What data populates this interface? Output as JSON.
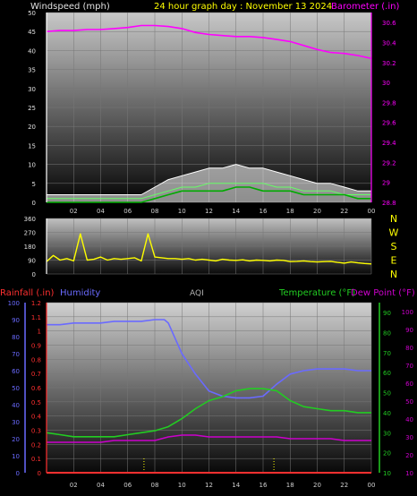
{
  "header": {
    "wind_label": "Windspeed (mph)",
    "title": "24 hour graph day : November 13 2024",
    "baro_label": "Barometer (.in)"
  },
  "lower_header": {
    "rain_label": "Rainfall (.in)",
    "humidity_label": "Humidity",
    "aqi_label": "AQI",
    "temp_label": "Temperature (°F)",
    "dew_label": "Dew Point (°F)"
  },
  "colors": {
    "wind_label": "#e0e0e0",
    "title": "#ffff00",
    "barometer": "#ff00ff",
    "direction": "#ffff00",
    "rain": "#ff3030",
    "humidity": "#6a6aff",
    "aqi": "#b0b0b0",
    "temperature": "#22cc22",
    "dew_point": "#cc00cc"
  },
  "compass": [
    "N",
    "W",
    "S",
    "E",
    "N"
  ],
  "chart_data": [
    {
      "type": "line",
      "name": "wind-barometer",
      "x_ticks": [
        "02",
        "04",
        "06",
        "08",
        "10",
        "12",
        "14",
        "16",
        "18",
        "20",
        "22",
        "00"
      ],
      "xlim": [
        0,
        24
      ],
      "left_ticks": [
        "0",
        "5",
        "10",
        "15",
        "20",
        "25",
        "30",
        "35",
        "40",
        "45",
        "50"
      ],
      "left_ylim": [
        0,
        50
      ],
      "right_ticks": [
        "28.8",
        "29",
        "29.2",
        "29.4",
        "29.6",
        "29.8",
        "30",
        "30.2",
        "30.4",
        "30.6"
      ],
      "right_ylim": [
        28.8,
        30.7
      ],
      "barometer": {
        "x": [
          0,
          1,
          2,
          3,
          4,
          5,
          6,
          7,
          8,
          9,
          10,
          11,
          12,
          13,
          14,
          15,
          16,
          17,
          18,
          19,
          20,
          21,
          22,
          23,
          24
        ],
        "y": [
          30.51,
          30.52,
          30.52,
          30.53,
          30.53,
          30.54,
          30.55,
          30.57,
          30.57,
          30.56,
          30.54,
          30.5,
          30.48,
          30.47,
          30.46,
          30.46,
          30.45,
          30.43,
          30.41,
          30.37,
          30.33,
          30.3,
          30.29,
          30.27,
          30.24
        ]
      },
      "wind_gust": {
        "x": [
          0,
          2,
          4,
          6,
          7,
          8,
          9,
          10,
          11,
          12,
          13,
          14,
          15,
          16,
          17,
          18,
          19,
          20,
          21,
          22,
          23,
          24
        ],
        "y": [
          2,
          2,
          2,
          2,
          2,
          4,
          6,
          7,
          8,
          9,
          9,
          10,
          9,
          9,
          8,
          7,
          6,
          5,
          5,
          4,
          3,
          3
        ]
      },
      "wind_avg": {
        "x": [
          0,
          2,
          4,
          6,
          7,
          8,
          9,
          10,
          11,
          12,
          13,
          14,
          15,
          16,
          17,
          18,
          19,
          20,
          21,
          22,
          23,
          24
        ],
        "y": [
          0,
          0,
          0,
          0,
          0,
          1,
          2,
          3,
          3,
          3,
          3,
          4,
          4,
          3,
          3,
          3,
          2,
          2,
          2,
          2,
          1,
          1
        ]
      },
      "wind_speed": {
        "x": [
          0,
          2,
          4,
          6,
          7,
          8,
          9,
          10,
          11,
          12,
          13,
          14,
          15,
          16,
          17,
          18,
          19,
          20,
          21,
          22,
          23,
          24
        ],
        "y": [
          1,
          1,
          1,
          1,
          1,
          2,
          3,
          4,
          4,
          5,
          5,
          5,
          5,
          5,
          4,
          4,
          3,
          3,
          3,
          2,
          2,
          2
        ]
      }
    },
    {
      "type": "line",
      "name": "wind-direction",
      "x_ticks": [
        "02",
        "04",
        "06",
        "08",
        "10",
        "12",
        "14",
        "16",
        "18",
        "20",
        "22",
        "00"
      ],
      "xlim": [
        0,
        24
      ],
      "ticks": [
        "0",
        "90",
        "180",
        "270",
        "360"
      ],
      "ylim": [
        0,
        360
      ],
      "direction": {
        "x": [
          0,
          0.5,
          1,
          1.5,
          2,
          2.5,
          3,
          3.5,
          4,
          4.5,
          5,
          5.5,
          6,
          6.5,
          7,
          7.5,
          8,
          8.5,
          9,
          9.5,
          10,
          10.5,
          11,
          11.5,
          12,
          12.5,
          13,
          13.5,
          14,
          14.5,
          15,
          15.5,
          16,
          16.5,
          17,
          17.5,
          18,
          18.5,
          19,
          19.5,
          20,
          20.5,
          21,
          21.5,
          22,
          22.5,
          23,
          23.5,
          24
        ],
        "y": [
          80,
          120,
          90,
          100,
          85,
          260,
          90,
          95,
          110,
          90,
          100,
          95,
          100,
          105,
          85,
          260,
          110,
          105,
          100,
          100,
          95,
          100,
          90,
          95,
          90,
          85,
          95,
          90,
          88,
          92,
          85,
          90,
          88,
          85,
          90,
          88,
          80,
          82,
          85,
          80,
          78,
          80,
          82,
          75,
          70,
          78,
          72,
          68,
          65
        ]
      }
    },
    {
      "type": "line",
      "name": "rain-humidity-temperature",
      "x_ticks": [
        "02",
        "04",
        "06",
        "08",
        "10",
        "12",
        "14",
        "16",
        "18",
        "20",
        "22",
        "00"
      ],
      "xlim": [
        0,
        24
      ],
      "humidity_ticks": [
        "0",
        "10",
        "20",
        "30",
        "40",
        "50",
        "60",
        "70",
        "80",
        "90",
        "100"
      ],
      "humidity_ylim": [
        0,
        100
      ],
      "rain_ticks": [
        "0",
        "0.1",
        "0.2",
        "0.3",
        "0.4",
        "0.5",
        "0.6",
        "0.7",
        "0.8",
        "0.9",
        "1",
        "1.1",
        "1.2"
      ],
      "rain_ylim": [
        0,
        1.2
      ],
      "temp_ticks": [
        "10",
        "20",
        "30",
        "40",
        "50",
        "60",
        "70",
        "80",
        "90"
      ],
      "temp_ylim": [
        10,
        95
      ],
      "dew_ticks": [
        "10",
        "20",
        "30",
        "40",
        "50",
        "60",
        "70",
        "80",
        "90",
        "100"
      ],
      "dew_ylim": [
        10,
        105
      ],
      "humidity": {
        "x": [
          0,
          1,
          2,
          3,
          4,
          5,
          6,
          7,
          8,
          8.7,
          9,
          10,
          11,
          12,
          13,
          14,
          15,
          16,
          17,
          18,
          19,
          20,
          21,
          22,
          23,
          24
        ],
        "y": [
          87,
          87,
          88,
          88,
          88,
          89,
          89,
          89,
          90,
          90,
          88,
          70,
          58,
          48,
          45,
          44,
          44,
          45,
          52,
          58,
          60,
          61,
          61,
          61,
          60,
          60
        ]
      },
      "temperature": {
        "x": [
          0,
          1,
          2,
          3,
          4,
          5,
          6,
          7,
          8,
          9,
          10,
          11,
          12,
          13,
          14,
          15,
          16,
          17,
          18,
          19,
          20,
          21,
          22,
          23,
          24
        ],
        "y": [
          30,
          29,
          28,
          28,
          28,
          28,
          29,
          30,
          31,
          33,
          37,
          42,
          46,
          48,
          51,
          52,
          52,
          51,
          46,
          43,
          42,
          41,
          41,
          40,
          40
        ]
      },
      "dew_point": {
        "x": [
          0,
          1,
          2,
          3,
          4,
          5,
          6,
          7,
          8,
          9,
          10,
          11,
          12,
          13,
          14,
          15,
          16,
          17,
          18,
          19,
          20,
          21,
          22,
          23,
          24
        ],
        "y": [
          27,
          27,
          27,
          27,
          27,
          28,
          28,
          28,
          28,
          30,
          31,
          31,
          30,
          30,
          30,
          30,
          30,
          30,
          29,
          29,
          29,
          29,
          28,
          28,
          28
        ]
      },
      "rainfall": {
        "x": [
          0,
          24
        ],
        "y": [
          0,
          0
        ]
      },
      "aqi": {
        "x": [
          7.2,
          16.8
        ],
        "y": [
          0.1,
          0.1
        ]
      }
    }
  ]
}
